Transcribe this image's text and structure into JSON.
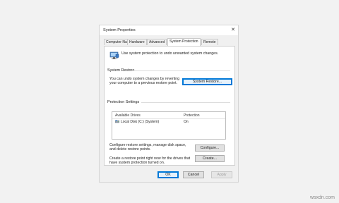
{
  "window": {
    "title": "System Properties",
    "close_glyph": "✕"
  },
  "tabs": [
    {
      "label": "Computer Name"
    },
    {
      "label": "Hardware"
    },
    {
      "label": "Advanced"
    },
    {
      "label": "System Protection",
      "active": true
    },
    {
      "label": "Remote"
    }
  ],
  "intro": {
    "text": "Use system protection to undo unwanted system changes.",
    "icon": "system-protection-icon"
  },
  "system_restore": {
    "heading": "System Restore",
    "desc_line1": "You can undo system changes by reverting",
    "desc_line2": "your computer to a previous restore point.",
    "button_label": "System Restore..."
  },
  "protection_settings": {
    "heading": "Protection Settings",
    "columns": [
      "Available Drives",
      "Protection"
    ],
    "drives": [
      {
        "name": "Local Disk (C:) (System)",
        "protection": "On",
        "icon": "drive-icon"
      }
    ]
  },
  "configure": {
    "desc_line1": "Configure restore settings, manage disk space,",
    "desc_line2": "and delete restore points.",
    "button_label": "Configure..."
  },
  "create": {
    "desc_line1": "Create a restore point right now for the drives that",
    "desc_line2": "have system protection turned on.",
    "button_label": "Create..."
  },
  "footer": {
    "ok": "OK",
    "cancel": "Cancel",
    "apply": "Apply"
  },
  "watermark": "wsxdn.com",
  "colors": {
    "accent": "#0078d7",
    "panel": "#ffffff",
    "chrome": "#f0f0f0"
  }
}
